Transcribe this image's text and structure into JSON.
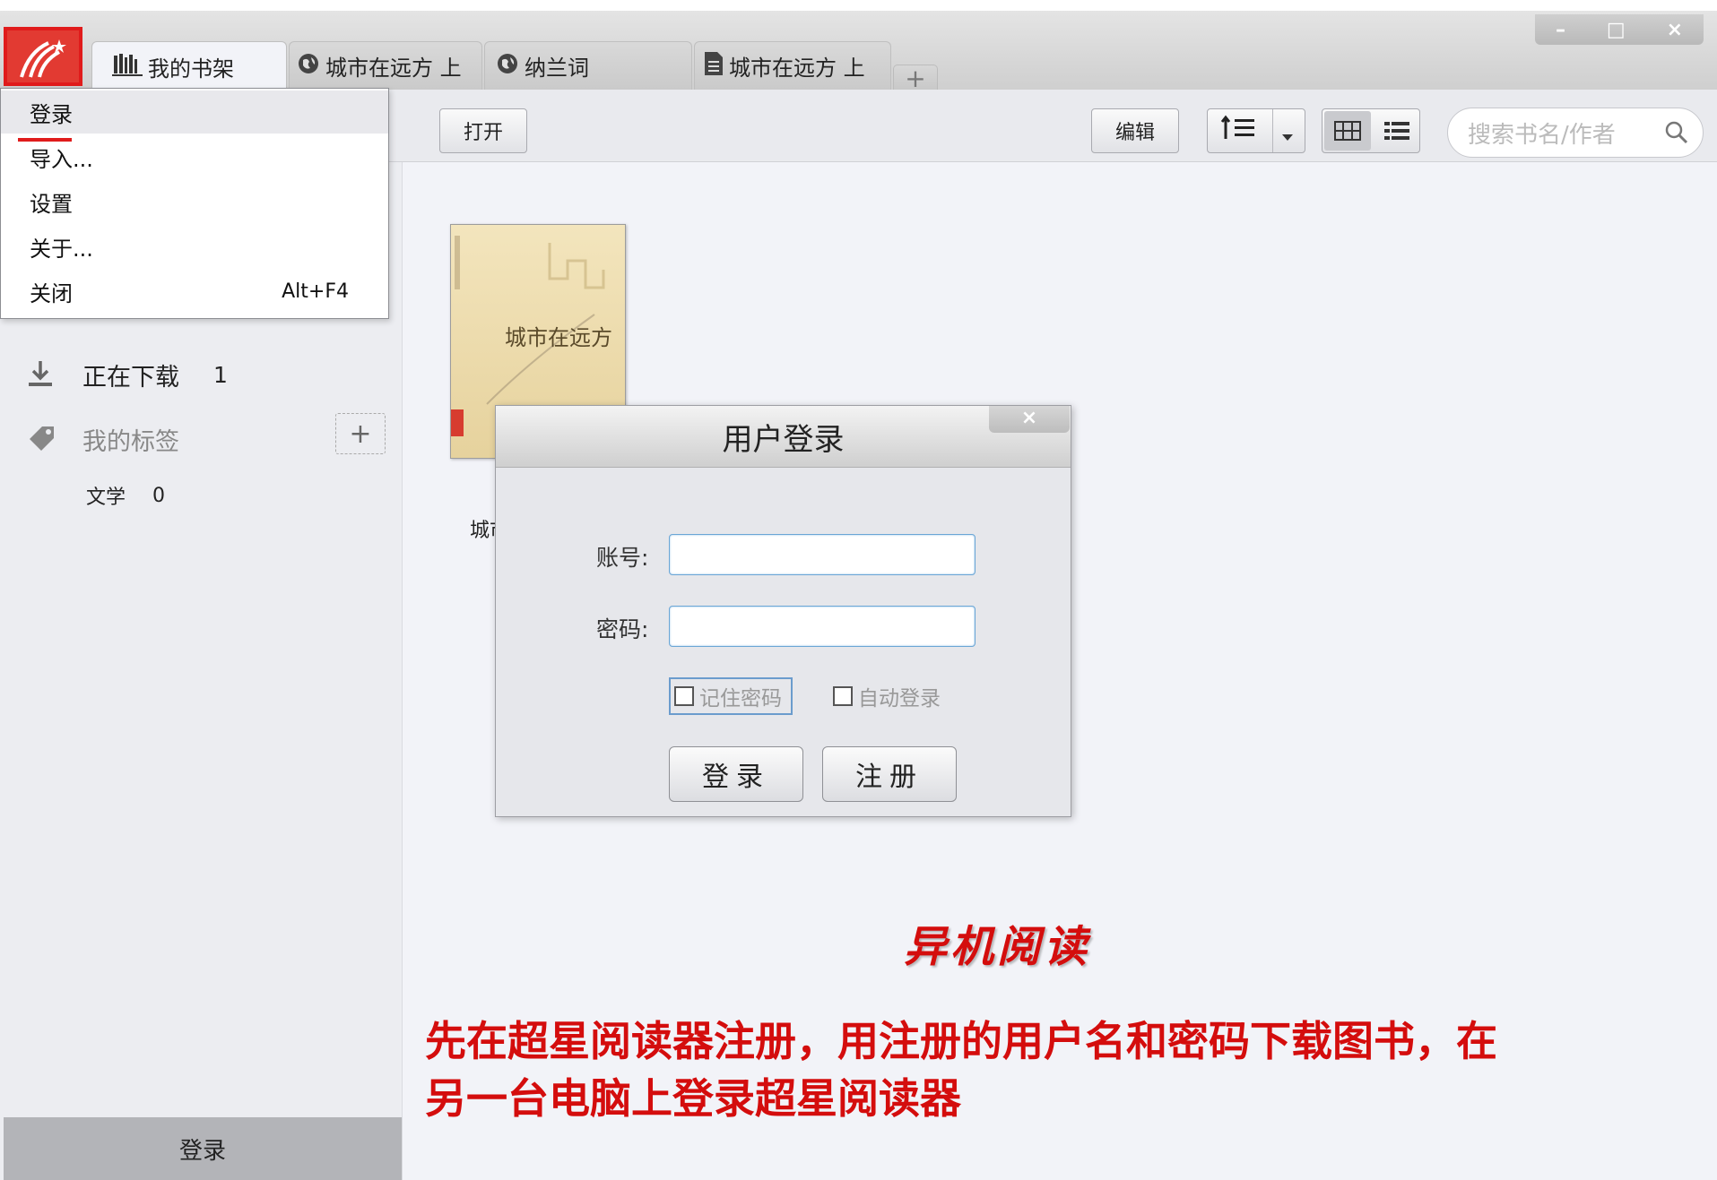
{
  "tabs": [
    {
      "label": "我的书架",
      "icon": "bookshelf-icon",
      "active": true
    },
    {
      "label": "城市在远方  上",
      "icon": "globe-icon"
    },
    {
      "label": "纳兰词",
      "icon": "globe-icon"
    },
    {
      "label": "城市在远方  上",
      "icon": "document-icon"
    }
  ],
  "tab_add": "+",
  "window_controls": {
    "minimize": "–",
    "maximize": "□",
    "close": "×"
  },
  "toolbar": {
    "open_label": "打开",
    "edit_label": "编辑",
    "search_placeholder": "搜索书名/作者"
  },
  "menu": {
    "items": [
      {
        "label": "登录"
      },
      {
        "label": "导入..."
      },
      {
        "label": "设置"
      },
      {
        "label": "关于..."
      },
      {
        "label": "关闭",
        "shortcut": "Alt+F4"
      }
    ]
  },
  "sidebar": {
    "downloading_label": "正在下载",
    "downloading_count": "1",
    "tags_label": "我的标签",
    "tag_add": "+",
    "tag_item_label": "文学",
    "tag_item_count": "0",
    "login_label": "登录"
  },
  "book": {
    "cover_title": "城市在远方",
    "caption": "城市"
  },
  "dialog": {
    "title": "用户登录",
    "close": "×",
    "account_label": "账号:",
    "password_label": "密码:",
    "remember_label": "记住密码",
    "auto_login_label": "自动登录",
    "login_button": "登录",
    "register_button": "注册"
  },
  "annotation": {
    "title": "异机阅读",
    "line1": "先在超星阅读器注册，用注册的用户名和密码下载图书，在",
    "line2": "另一台电脑上登录超星阅读器"
  },
  "colors": {
    "accent_red": "#d40d0d",
    "focus_blue": "#6aa6d6"
  }
}
